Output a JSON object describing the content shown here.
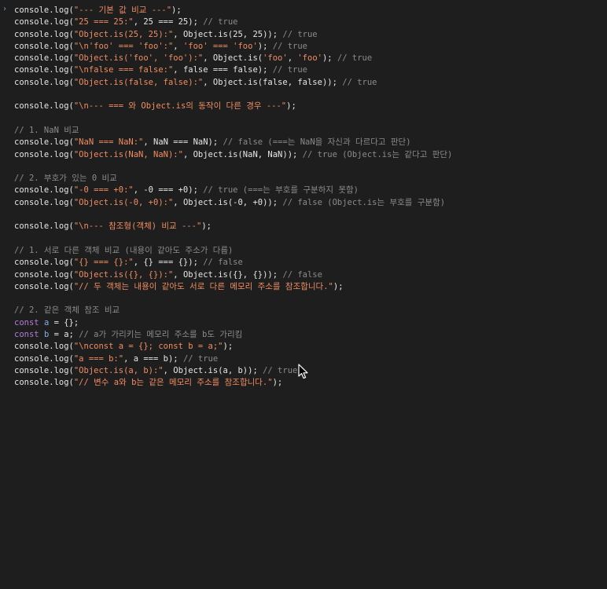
{
  "console": {
    "prompt_symbol": "›",
    "lines": [
      [
        [
          "fn",
          "console.log("
        ],
        [
          "str",
          "\"--- 기본 값 비교 ---\""
        ],
        [
          "fn",
          ");"
        ]
      ],
      [
        [
          "fn",
          "console.log("
        ],
        [
          "str",
          "\"25 === 25:\""
        ],
        [
          "fn",
          ", 25 === 25); "
        ],
        [
          "cmt",
          "// true"
        ]
      ],
      [
        [
          "fn",
          "console.log("
        ],
        [
          "str",
          "\"Object.is(25, 25):\""
        ],
        [
          "fn",
          ", Object.is(25, 25)); "
        ],
        [
          "cmt",
          "// true"
        ]
      ],
      [
        [
          "fn",
          "console.log("
        ],
        [
          "str",
          "\"\\n'foo' === 'foo':\""
        ],
        [
          "fn",
          ", "
        ],
        [
          "str",
          "'foo' === 'foo'"
        ],
        [
          "fn",
          "); "
        ],
        [
          "cmt",
          "// true"
        ]
      ],
      [
        [
          "fn",
          "console.log("
        ],
        [
          "str",
          "\"Object.is('foo', 'foo'):\""
        ],
        [
          "fn",
          ", Object.is("
        ],
        [
          "str",
          "'foo'"
        ],
        [
          "fn",
          ", "
        ],
        [
          "str",
          "'foo'"
        ],
        [
          "fn",
          "); "
        ],
        [
          "cmt",
          "// true"
        ]
      ],
      [
        [
          "fn",
          "console.log("
        ],
        [
          "str",
          "\"\\nfalse === false:\""
        ],
        [
          "fn",
          ", false === false); "
        ],
        [
          "cmt",
          "// true"
        ]
      ],
      [
        [
          "fn",
          "console.log("
        ],
        [
          "str",
          "\"Object.is(false, false):\""
        ],
        [
          "fn",
          ", Object.is(false, false)); "
        ],
        [
          "cmt",
          "// true"
        ]
      ],
      [],
      [
        [
          "fn",
          "console.log("
        ],
        [
          "str",
          "\"\\n--- === 와 Object.is의 동작이 다른 경우 ---\""
        ],
        [
          "fn",
          ");"
        ]
      ],
      [],
      [
        [
          "cmt",
          "// 1. NaN 비교"
        ]
      ],
      [
        [
          "fn",
          "console.log("
        ],
        [
          "str",
          "\"NaN === NaN:\""
        ],
        [
          "fn",
          ", NaN === NaN); "
        ],
        [
          "cmt",
          "// false (===는 NaN을 자신과 다르다고 판단)"
        ]
      ],
      [
        [
          "fn",
          "console.log("
        ],
        [
          "str",
          "\"Object.is(NaN, NaN):\""
        ],
        [
          "fn",
          ", Object.is(NaN, NaN)); "
        ],
        [
          "cmt",
          "// true (Object.is는 같다고 판단)"
        ]
      ],
      [],
      [
        [
          "cmt",
          "// 2. 부호가 있는 0 비교"
        ]
      ],
      [
        [
          "fn",
          "console.log("
        ],
        [
          "str",
          "\"-0 === +0:\""
        ],
        [
          "fn",
          ", -0 === +0); "
        ],
        [
          "cmt",
          "// true (===는 부호를 구분하지 못함)"
        ]
      ],
      [
        [
          "fn",
          "console.log("
        ],
        [
          "str",
          "\"Object.is(-0, +0):\""
        ],
        [
          "fn",
          ", Object.is(-0, +0)); "
        ],
        [
          "cmt",
          "// false (Object.is는 부호를 구분함)"
        ]
      ],
      [],
      [
        [
          "fn",
          "console.log("
        ],
        [
          "str",
          "\"\\n--- 참조형(객체) 비교 ---\""
        ],
        [
          "fn",
          ");"
        ]
      ],
      [],
      [
        [
          "cmt",
          "// 1. 서로 다른 객체 비교 (내용이 같아도 주소가 다름)"
        ]
      ],
      [
        [
          "fn",
          "console.log("
        ],
        [
          "str",
          "\"{} === {}:\""
        ],
        [
          "fn",
          ", {} === {}); "
        ],
        [
          "cmt",
          "// false"
        ]
      ],
      [
        [
          "fn",
          "console.log("
        ],
        [
          "str",
          "\"Object.is({}, {}):\""
        ],
        [
          "fn",
          ", Object.is({}, {})); "
        ],
        [
          "cmt",
          "// false"
        ]
      ],
      [
        [
          "fn",
          "console.log("
        ],
        [
          "str",
          "\"// 두 객체는 내용이 같아도 서로 다른 메모리 주소를 참조합니다.\""
        ],
        [
          "fn",
          ");"
        ]
      ],
      [],
      [
        [
          "cmt",
          "// 2. 같은 객체 참조 비교"
        ]
      ],
      [
        [
          "kw",
          "const"
        ],
        [
          "fn",
          " "
        ],
        [
          "var",
          "a"
        ],
        [
          "fn",
          " = {};"
        ]
      ],
      [
        [
          "kw",
          "const"
        ],
        [
          "fn",
          " "
        ],
        [
          "var",
          "b"
        ],
        [
          "fn",
          " = a; "
        ],
        [
          "cmt",
          "// a가 가리키는 메모리 주소를 b도 가리킴"
        ]
      ],
      [
        [
          "fn",
          "console.log("
        ],
        [
          "str",
          "\"\\nconst a = {}; const b = a;\""
        ],
        [
          "fn",
          ");"
        ]
      ],
      [
        [
          "fn",
          "console.log("
        ],
        [
          "str",
          "\"a === b:\""
        ],
        [
          "fn",
          ", a === b); "
        ],
        [
          "cmt",
          "// true"
        ]
      ],
      [
        [
          "fn",
          "console.log("
        ],
        [
          "str",
          "\"Object.is(a, b):\""
        ],
        [
          "fn",
          ", Object.is(a, b)); "
        ],
        [
          "cmt",
          "// true"
        ]
      ],
      [
        [
          "fn",
          "console.log("
        ],
        [
          "str",
          "\"// 변수 a와 b는 같은 메모리 주소를 참조합니다.\""
        ],
        [
          "fn",
          ");"
        ]
      ]
    ]
  },
  "colors": {
    "background": "#1e1e1e",
    "default_text": "#e6e6e6",
    "string": "#ef8d62",
    "comment": "#8b8b8b",
    "keyword": "#b07cd8",
    "variable": "#7fb0e8",
    "prompt": "#6a9fd6"
  },
  "cursor_icon": "mouse-pointer-icon"
}
